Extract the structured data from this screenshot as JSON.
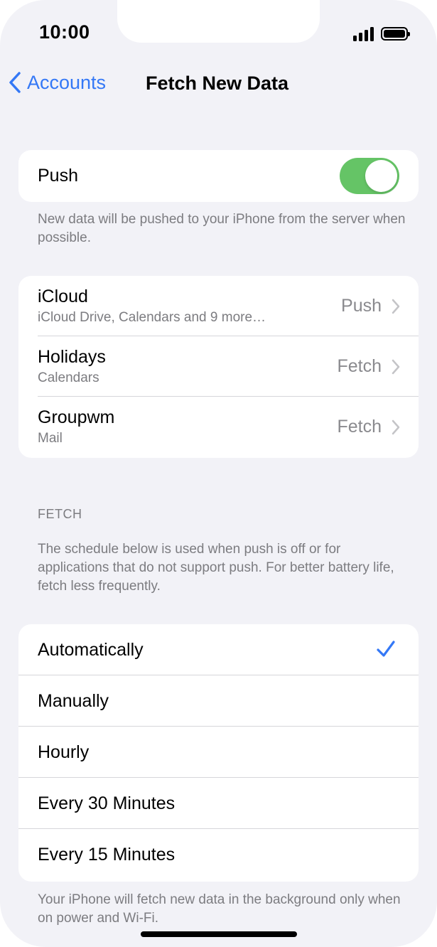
{
  "status_bar": {
    "time": "10:00"
  },
  "nav": {
    "back_label": "Accounts",
    "title": "Fetch New Data"
  },
  "push": {
    "label": "Push",
    "enabled": true,
    "footnote": "New data will be pushed to your iPhone from the server when possible."
  },
  "accounts": [
    {
      "name": "iCloud",
      "detail": "iCloud Drive, Calendars and 9 more…",
      "mode": "Push"
    },
    {
      "name": "Holidays",
      "detail": "Calendars",
      "mode": "Fetch"
    },
    {
      "name": "Groupwm",
      "detail": "Mail",
      "mode": "Fetch"
    }
  ],
  "fetch": {
    "header": "FETCH",
    "description": "The schedule below is used when push is off or for applications that do not support push. For better battery life, fetch less frequently.",
    "options": [
      "Automatically",
      "Manually",
      "Hourly",
      "Every 30 Minutes",
      "Every 15 Minutes"
    ],
    "selected": "Automatically",
    "footnote": "Your iPhone will fetch new data in the background only when on power and Wi-Fi."
  },
  "colors": {
    "accent": "#3478f6",
    "toggle_on": "#65c466",
    "background": "#f2f2f7",
    "secondary_text": "#7c7c80"
  }
}
